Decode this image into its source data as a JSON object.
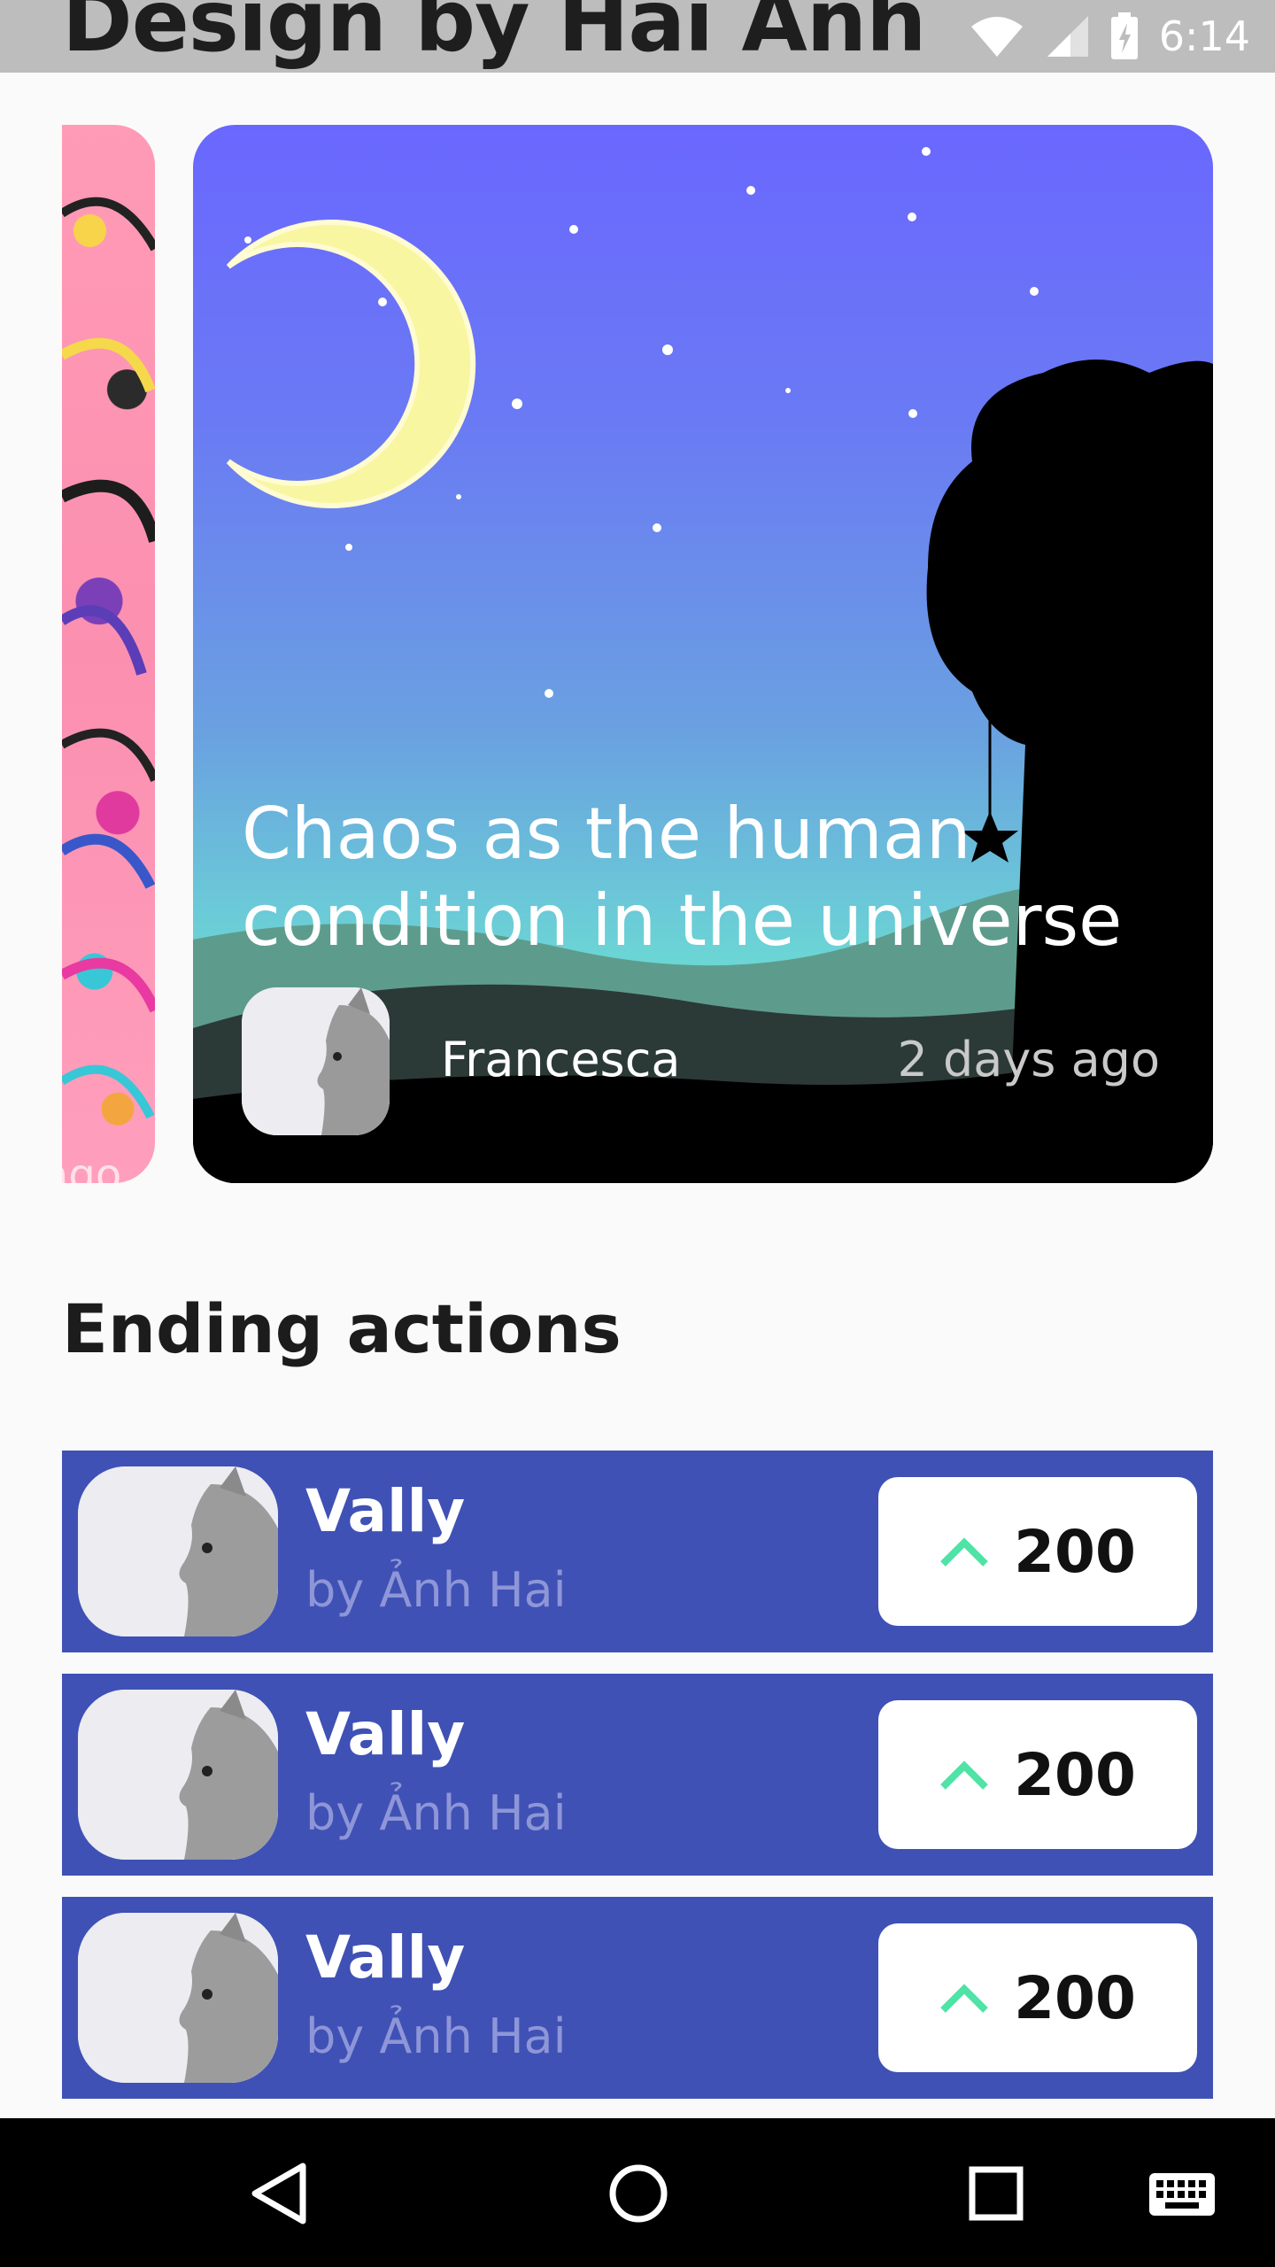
{
  "header": {
    "title": "Design by Hai Anh"
  },
  "status_bar": {
    "time": "6:14"
  },
  "carousel": {
    "peek_card": {
      "time": "ago"
    },
    "feature_card": {
      "title": "Chaos as the human condition in the universe",
      "author": "Francesca",
      "time": "2 days ago"
    }
  },
  "section": {
    "title": "Ending actions"
  },
  "actions": [
    {
      "name": "Vally",
      "by": "by Ảnh Hai",
      "votes": "200"
    },
    {
      "name": "Vally",
      "by": "by Ảnh Hai",
      "votes": "200"
    },
    {
      "name": "Vally",
      "by": "by Ảnh Hai",
      "votes": "200"
    }
  ],
  "colors": {
    "accent": "#3f51b5",
    "upvote": "#4fe3a6",
    "background": "#fafafa"
  }
}
